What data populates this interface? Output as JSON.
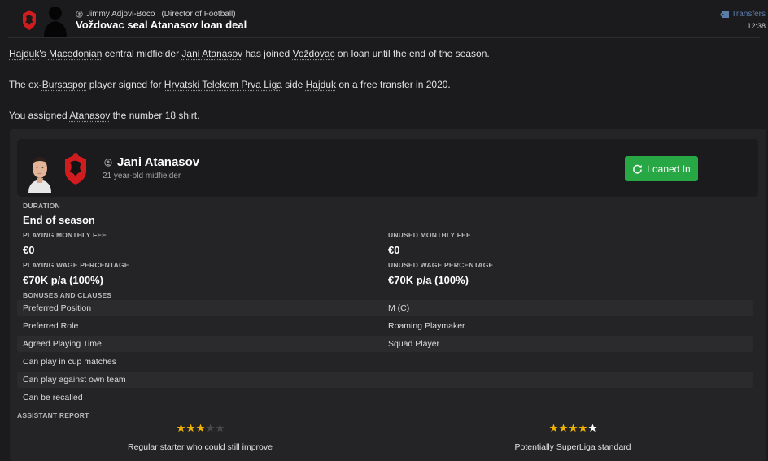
{
  "message": {
    "sender_name": "Jimmy Adjovi-Boco",
    "sender_role": "(Director of Football)",
    "headline": "Voždovac seal Atanasov loan deal",
    "category": "Transfers",
    "time": "12:38"
  },
  "body": {
    "para1": {
      "p1": "Hajduk",
      "p2": "'s ",
      "p3": "Macedonian",
      "p4": " central midfielder ",
      "p5": "Jani Atanasov",
      "p6": " has joined ",
      "p7": "Voždovac",
      "p8": " on loan until the end of the season."
    },
    "para2": {
      "p1": "The ex-",
      "p2": "Bursaspor",
      "p3": " player signed for ",
      "p4": "Hrvatski Telekom Prva Liga",
      "p5": " side ",
      "p6": "Hajduk",
      "p7": " on a free transfer in 2020."
    },
    "para3": {
      "p1": "You assigned ",
      "p2": "Atanasov",
      "p3": " the number 18 shirt."
    }
  },
  "player": {
    "name": "Jani Atanasov",
    "description": "21 year-old midfielder",
    "status_label": "Loaned In"
  },
  "deal": {
    "duration_label": "DURATION",
    "duration_value": "End of season",
    "playing_fee_label": "PLAYING MONTHLY FEE",
    "playing_fee_value": "€0",
    "unused_fee_label": "UNUSED MONTHLY FEE",
    "unused_fee_value": "€0",
    "playing_wage_label": "PLAYING WAGE PERCENTAGE",
    "playing_wage_value": "€70K p/a (100%)",
    "unused_wage_label": "UNUSED WAGE PERCENTAGE",
    "unused_wage_value": "€70K p/a (100%)",
    "bonuses_label": "BONUSES AND CLAUSES"
  },
  "clauses": [
    {
      "key": "Preferred Position",
      "value": "M (C)"
    },
    {
      "key": "Preferred Role",
      "value": "Roaming Playmaker"
    },
    {
      "key": "Agreed Playing Time",
      "value": "Squad Player"
    },
    {
      "key": "Can play in cup matches",
      "value": ""
    },
    {
      "key": "Can play against own team",
      "value": ""
    },
    {
      "key": "Can be recalled",
      "value": ""
    }
  ],
  "assistant_report": {
    "label": "ASSISTANT REPORT",
    "current": {
      "stars": 3,
      "text": "Regular starter who could still improve"
    },
    "potential": {
      "stars": 4,
      "text": "Potentially SuperLiga standard"
    }
  },
  "colors": {
    "background": "#1b1b1d",
    "card": "#242427",
    "status_green": "#28a745",
    "star_gold": "#f0b400",
    "category_blue": "#5b7da8",
    "club_red": "#d01c1f"
  }
}
